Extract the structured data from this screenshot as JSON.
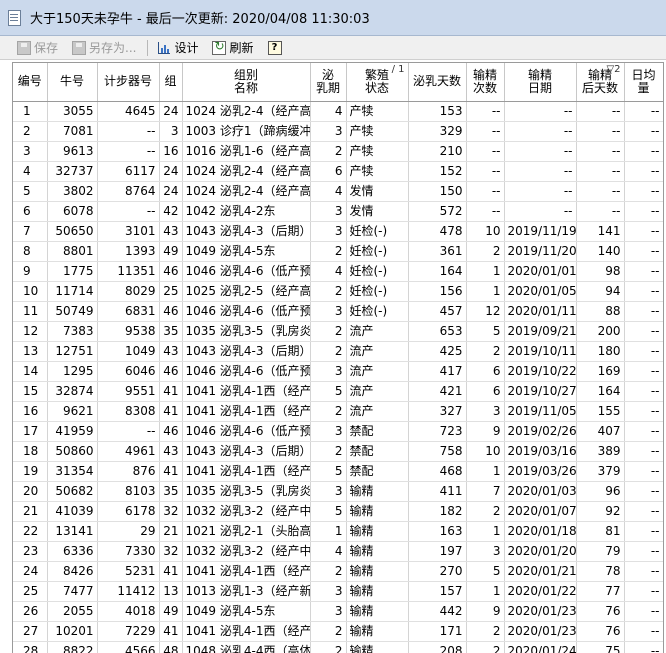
{
  "window": {
    "title": "大于150天未孕牛 - 最后一次更新: 2020/04/08 11:30:03"
  },
  "toolbar": {
    "save_label": "保存",
    "saveas_label": "另存为...",
    "design_label": "设计",
    "refresh_label": "刷新",
    "help_label": "?"
  },
  "table": {
    "columns": [
      {
        "line1": "编号",
        "line2": ""
      },
      {
        "line1": "牛号",
        "line2": ""
      },
      {
        "line1": "计步器号",
        "line2": ""
      },
      {
        "line1": "组",
        "line2": ""
      },
      {
        "line1": "组别",
        "line2": "名称"
      },
      {
        "line1": "泌",
        "line2": "乳期"
      },
      {
        "line1": "繁殖",
        "line2": "状态",
        "sort": "/ 1"
      },
      {
        "line1": "泌乳天数",
        "line2": ""
      },
      {
        "line1": "输精",
        "line2": "次数"
      },
      {
        "line1": "输精",
        "line2": "日期"
      },
      {
        "line1": "输精",
        "line2": "后天数",
        "sort": "▽2"
      },
      {
        "line1": "日均",
        "line2": "量"
      }
    ],
    "rows": [
      [
        "1",
        "3055",
        "4645",
        "24",
        "1024 泌乳2-4（经产高产",
        "4",
        "产犊",
        "153",
        "--",
        "--",
        "--",
        "--"
      ],
      [
        "2",
        "7081",
        "--",
        "3",
        "1003 诊疗1（蹄病缓冲区",
        "3",
        "产犊",
        "329",
        "--",
        "--",
        "--",
        "--"
      ],
      [
        "3",
        "9613",
        "--",
        "16",
        "1016 泌乳1-6（经产高产",
        "2",
        "产犊",
        "210",
        "--",
        "--",
        "--",
        "--"
      ],
      [
        "4",
        "32737",
        "6117",
        "24",
        "1024 泌乳2-4（经产高产",
        "6",
        "产犊",
        "152",
        "--",
        "--",
        "--",
        "--"
      ],
      [
        "5",
        "3802",
        "8764",
        "24",
        "1024 泌乳2-4（经产高产",
        "4",
        "发情",
        "150",
        "--",
        "--",
        "--",
        "--"
      ],
      [
        "6",
        "6078",
        "--",
        "42",
        "1042 泌乳4-2东",
        "3",
        "发情",
        "572",
        "--",
        "--",
        "--",
        "--"
      ],
      [
        "7",
        "50650",
        "3101",
        "43",
        "1043 泌乳4-3（后期）",
        "3",
        "妊检(-)",
        "478",
        "10",
        "2019/11/19",
        "141",
        "--"
      ],
      [
        "8",
        "8801",
        "1393",
        "49",
        "1049 泌乳4-5东",
        "2",
        "妊检(-)",
        "361",
        "2",
        "2019/11/20",
        "140",
        "--"
      ],
      [
        "9",
        "1775",
        "11351",
        "46",
        "1046 泌乳4-6（低产预满",
        "4",
        "妊检(-)",
        "164",
        "1",
        "2020/01/01",
        "98",
        "--"
      ],
      [
        "10",
        "11714",
        "8029",
        "25",
        "1025 泌乳2-5（经产高产",
        "2",
        "妊检(-)",
        "156",
        "1",
        "2020/01/05",
        "94",
        "--"
      ],
      [
        "11",
        "50749",
        "6831",
        "46",
        "1046 泌乳4-6（低产预满",
        "3",
        "妊检(-)",
        "457",
        "12",
        "2020/01/11",
        "88",
        "--"
      ],
      [
        "12",
        "7383",
        "9538",
        "35",
        "1035 泌乳3-5（乳房炎缓",
        "2",
        "流产",
        "653",
        "5",
        "2019/09/21",
        "200",
        "--"
      ],
      [
        "13",
        "12751",
        "1049",
        "43",
        "1043 泌乳4-3（后期）",
        "2",
        "流产",
        "425",
        "2",
        "2019/10/11",
        "180",
        "--"
      ],
      [
        "14",
        "1295",
        "6046",
        "46",
        "1046 泌乳4-6（低产预满",
        "3",
        "流产",
        "417",
        "6",
        "2019/10/22",
        "169",
        "--"
      ],
      [
        "15",
        "32874",
        "9551",
        "41",
        "1041 泌乳4-1西（经产中",
        "5",
        "流产",
        "421",
        "6",
        "2019/10/27",
        "164",
        "--"
      ],
      [
        "16",
        "9621",
        "8308",
        "41",
        "1041 泌乳4-1西（经产中",
        "2",
        "流产",
        "327",
        "3",
        "2019/11/05",
        "155",
        "--"
      ],
      [
        "17",
        "41959",
        "--",
        "46",
        "1046 泌乳4-6（低产预满",
        "3",
        "禁配",
        "723",
        "9",
        "2019/02/26",
        "407",
        "--"
      ],
      [
        "18",
        "50860",
        "4961",
        "43",
        "1043 泌乳4-3（后期）",
        "2",
        "禁配",
        "758",
        "10",
        "2019/03/16",
        "389",
        "--"
      ],
      [
        "19",
        "31354",
        "876",
        "41",
        "1041 泌乳4-1西（经产中",
        "5",
        "禁配",
        "468",
        "1",
        "2019/03/26",
        "379",
        "--"
      ],
      [
        "20",
        "50682",
        "8103",
        "35",
        "1035 泌乳3-5（乳房炎缓",
        "3",
        "输精",
        "411",
        "7",
        "2020/01/03",
        "96",
        "--"
      ],
      [
        "21",
        "41039",
        "6178",
        "32",
        "1032 泌乳3-2（经产中期",
        "5",
        "输精",
        "182",
        "2",
        "2020/01/07",
        "92",
        "--"
      ],
      [
        "22",
        "13141",
        "29",
        "21",
        "1021 泌乳2-1（头胎高产",
        "1",
        "输精",
        "163",
        "1",
        "2020/01/18",
        "81",
        "--"
      ],
      [
        "23",
        "6336",
        "7330",
        "32",
        "1032 泌乳3-2（经产中期",
        "4",
        "输精",
        "197",
        "3",
        "2020/01/20",
        "79",
        "--"
      ],
      [
        "24",
        "8426",
        "5231",
        "41",
        "1041 泌乳4-1西（经产中",
        "2",
        "输精",
        "270",
        "5",
        "2020/01/21",
        "78",
        "--"
      ],
      [
        "25",
        "7477",
        "11412",
        "13",
        "1013 泌乳1-3（经产新产",
        "3",
        "输精",
        "157",
        "1",
        "2020/01/22",
        "77",
        "--"
      ],
      [
        "26",
        "2055",
        "4018",
        "49",
        "1049 泌乳4-5东",
        "3",
        "输精",
        "442",
        "9",
        "2020/01/23",
        "76",
        "--"
      ],
      [
        "27",
        "10201",
        "7229",
        "41",
        "1041 泌乳4-1西（经产中",
        "2",
        "输精",
        "171",
        "2",
        "2020/01/23",
        "76",
        "--"
      ],
      [
        "28",
        "8822",
        "4566",
        "48",
        "1048 泌乳4-4西（高体生",
        "2",
        "输精",
        "208",
        "2",
        "2020/01/24",
        "75",
        "--"
      ]
    ]
  }
}
